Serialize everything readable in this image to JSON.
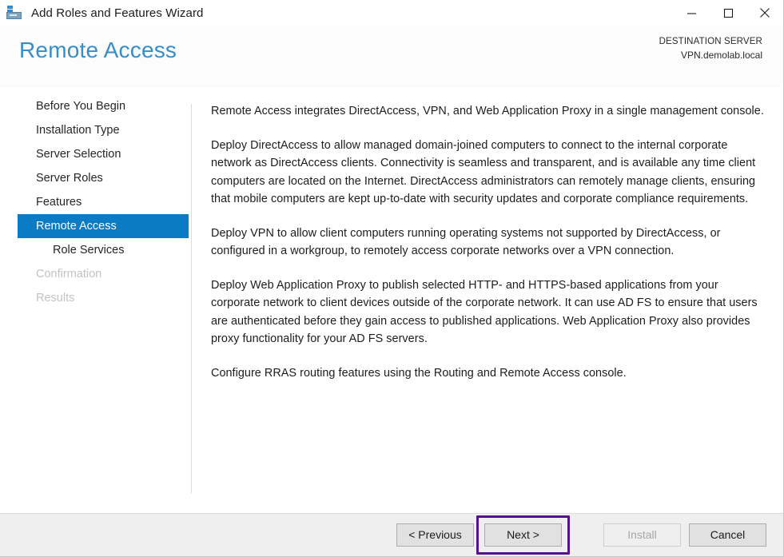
{
  "window": {
    "title": "Add Roles and Features Wizard",
    "icon": "server-roles-icon",
    "controls": {
      "minimize": "minimize-icon",
      "maximize": "maximize-icon",
      "close": "close-icon"
    }
  },
  "header": {
    "page_title": "Remote Access",
    "destination_label": "DESTINATION SERVER",
    "destination_value": "VPN.demolab.local"
  },
  "sidebar": {
    "items": [
      {
        "label": "Before You Begin",
        "state": "normal",
        "indent": false
      },
      {
        "label": "Installation Type",
        "state": "normal",
        "indent": false
      },
      {
        "label": "Server Selection",
        "state": "normal",
        "indent": false
      },
      {
        "label": "Server Roles",
        "state": "normal",
        "indent": false
      },
      {
        "label": "Features",
        "state": "normal",
        "indent": false
      },
      {
        "label": "Remote Access",
        "state": "active",
        "indent": false
      },
      {
        "label": "Role Services",
        "state": "normal",
        "indent": true
      },
      {
        "label": "Confirmation",
        "state": "disabled",
        "indent": false
      },
      {
        "label": "Results",
        "state": "disabled",
        "indent": false
      }
    ]
  },
  "content": {
    "paragraphs": [
      "Remote Access integrates DirectAccess, VPN, and Web Application Proxy in a single management console.",
      "Deploy DirectAccess to allow managed domain-joined computers to connect to the internal corporate network as DirectAccess clients. Connectivity is seamless and transparent, and is available any time client computers are located on the Internet. DirectAccess administrators can remotely manage clients, ensuring that mobile computers are kept up-to-date with security updates and corporate compliance requirements.",
      "Deploy VPN to allow client computers running operating systems not supported by DirectAccess, or configured in a workgroup, to remotely access corporate networks over a VPN connection.",
      "Deploy Web Application Proxy to publish selected HTTP- and HTTPS-based applications from your corporate network to client devices outside of the corporate network. It can use AD FS to ensure that users are authenticated before they gain access to published applications. Web Application Proxy also provides proxy functionality for your AD FS servers.",
      "Configure RRAS routing features using the Routing and Remote Access console."
    ]
  },
  "footer": {
    "previous_label": "< Previous",
    "next_label": "Next >",
    "install_label": "Install",
    "cancel_label": "Cancel",
    "install_disabled": true,
    "highlight_color": "#54128c",
    "accent_color": "#0a7bc4"
  }
}
